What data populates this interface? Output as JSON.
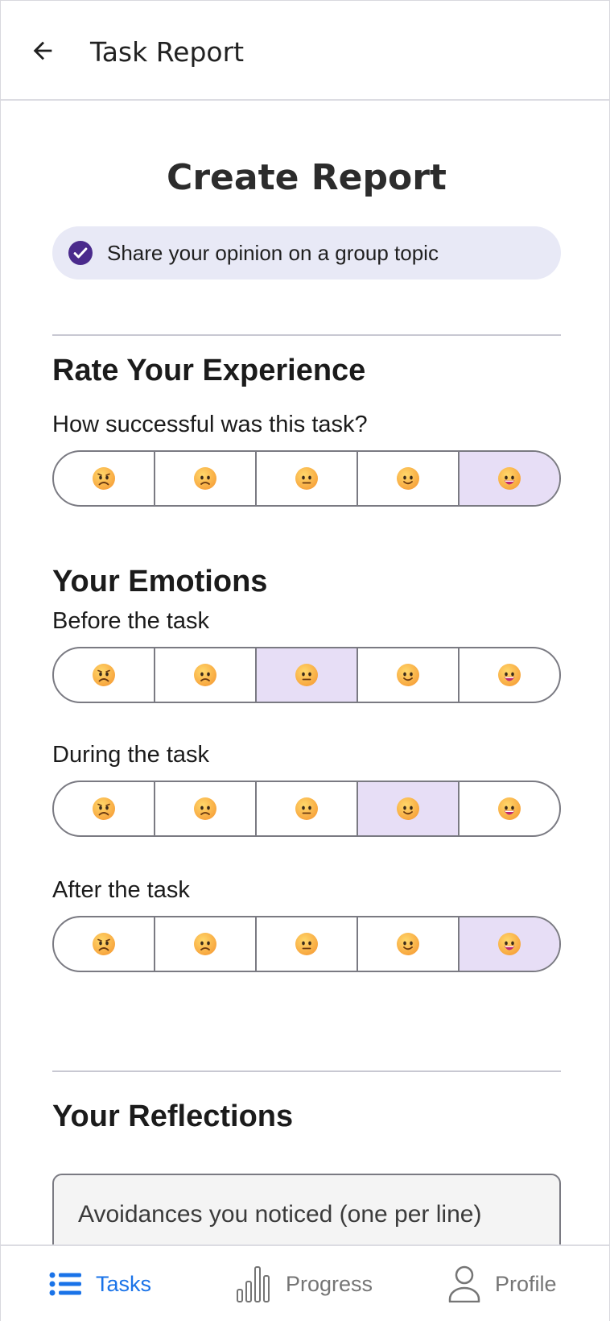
{
  "appbar": {
    "title": "Task Report",
    "back_icon": "arrow-left-icon"
  },
  "page": {
    "title": "Create Report"
  },
  "topic": {
    "text": "Share your opinion on a group topic",
    "icon": "check-circle-icon",
    "icon_color": "#4a2a8c"
  },
  "rate": {
    "title": "Rate Your Experience",
    "question": "How successful was this task?",
    "options": [
      "anxious-face",
      "frowning-face",
      "neutral-face",
      "slightly-smiling-face",
      "grinning-face"
    ],
    "selected": 4
  },
  "emotions": {
    "title": "Your Emotions",
    "before": {
      "label": "Before the task",
      "selected": 2
    },
    "during": {
      "label": "During the task",
      "selected": 3
    },
    "after": {
      "label": "After the task",
      "selected": 4
    }
  },
  "reflections": {
    "title": "Your Reflections",
    "avoidances_placeholder": "Avoidances you noticed (one per line)"
  },
  "nav": {
    "tasks": {
      "label": "Tasks",
      "icon": "list-icon",
      "active": true
    },
    "progress": {
      "label": "Progress",
      "icon": "bar-chart-icon"
    },
    "profile": {
      "label": "Profile",
      "icon": "person-icon"
    }
  },
  "colors": {
    "selected_bg": "#e7def6",
    "accent_blue": "#1a73e8",
    "topic_bg": "#e8e9f6"
  }
}
